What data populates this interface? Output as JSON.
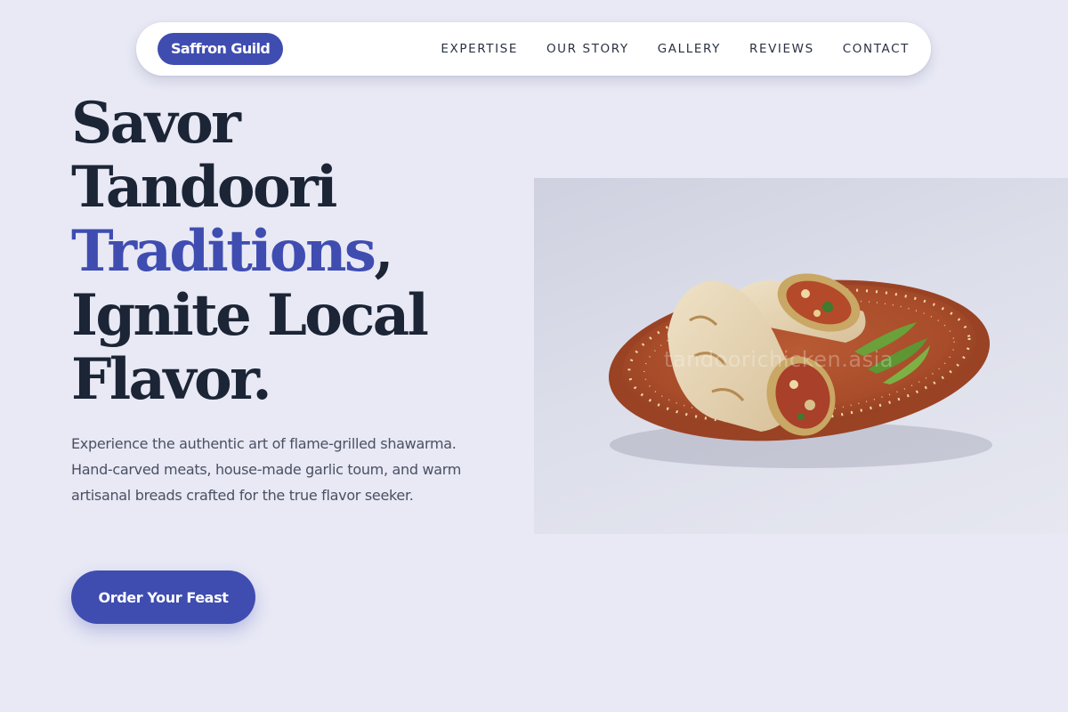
{
  "brand": {
    "logo_text": "Saffron Guild"
  },
  "nav": {
    "items": [
      {
        "label": "EXPERTISE"
      },
      {
        "label": "OUR STORY"
      },
      {
        "label": "GALLERY"
      },
      {
        "label": "REVIEWS"
      },
      {
        "label": "CONTACT"
      }
    ]
  },
  "hero": {
    "title_line1": "Savor",
    "title_line2": "Tandoori",
    "title_accent": "Traditions",
    "title_comma": ",",
    "title_line4": "Ignite Local",
    "title_line5": "Flavor.",
    "description": "Experience the authentic art of flame-grilled shawarma. Hand-carved meats, house-made garlic toum, and warm artisanal breads crafted for the true flavor seeker.",
    "cta_label": "Order Your Feast",
    "image_watermark": "tandoorichicken.asia"
  },
  "colors": {
    "accent": "#3f4db1",
    "background": "#e8e9f5",
    "heading": "#1c2536",
    "body_text": "#4a5063"
  }
}
